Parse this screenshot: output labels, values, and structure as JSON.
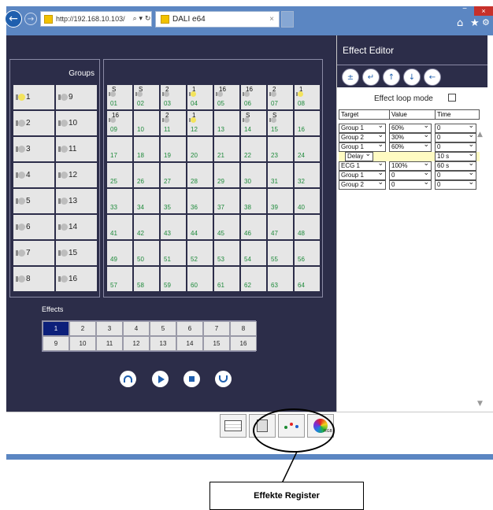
{
  "browser": {
    "url": "http://192.168.10.103/",
    "addr_tools": "⌕ ▾ ↻",
    "tab_title": "DALI e64",
    "tab_close": "×",
    "back_icon": "←",
    "forward_icon": "→",
    "min_icon": "−",
    "max_icon": "□",
    "close_icon": "×",
    "home_icon": "⌂",
    "star_icon": "★",
    "gear_icon": "⚙"
  },
  "groups": {
    "title": "Groups",
    "items": [
      {
        "label": "1",
        "on": true
      },
      {
        "label": "9",
        "on": false
      },
      {
        "label": "2",
        "on": false
      },
      {
        "label": "10",
        "on": false
      },
      {
        "label": "3",
        "on": false
      },
      {
        "label": "11",
        "on": false
      },
      {
        "label": "4",
        "on": false
      },
      {
        "label": "12",
        "on": false
      },
      {
        "label": "5",
        "on": false
      },
      {
        "label": "13",
        "on": false
      },
      {
        "label": "6",
        "on": false
      },
      {
        "label": "14",
        "on": false
      },
      {
        "label": "7",
        "on": false
      },
      {
        "label": "15",
        "on": false
      },
      {
        "label": "8",
        "on": false
      },
      {
        "label": "16",
        "on": false
      }
    ]
  },
  "ecgs": [
    {
      "num": "01",
      "tag": "S",
      "bulb": "off"
    },
    {
      "num": "02",
      "tag": "S",
      "bulb": "off"
    },
    {
      "num": "03",
      "tag": "2",
      "bulb": "off"
    },
    {
      "num": "04",
      "tag": "1",
      "bulb": "on"
    },
    {
      "num": "05",
      "tag": "16",
      "bulb": "off"
    },
    {
      "num": "06",
      "tag": "16",
      "bulb": "off"
    },
    {
      "num": "07",
      "tag": "2",
      "bulb": "off"
    },
    {
      "num": "08",
      "tag": "1",
      "bulb": "on"
    },
    {
      "num": "09",
      "tag": "16",
      "bulb": "off"
    },
    {
      "num": "10",
      "tag": "",
      "bulb": ""
    },
    {
      "num": "11",
      "tag": "2",
      "bulb": "off"
    },
    {
      "num": "12",
      "tag": "1",
      "bulb": "on"
    },
    {
      "num": "13",
      "tag": "",
      "bulb": ""
    },
    {
      "num": "14",
      "tag": "S",
      "bulb": "off"
    },
    {
      "num": "15",
      "tag": "S",
      "bulb": "off"
    },
    {
      "num": "16",
      "tag": "",
      "bulb": ""
    },
    {
      "num": "17",
      "tag": "",
      "bulb": ""
    },
    {
      "num": "18",
      "tag": "",
      "bulb": ""
    },
    {
      "num": "19",
      "tag": "",
      "bulb": ""
    },
    {
      "num": "20",
      "tag": "",
      "bulb": ""
    },
    {
      "num": "21",
      "tag": "",
      "bulb": ""
    },
    {
      "num": "22",
      "tag": "",
      "bulb": ""
    },
    {
      "num": "23",
      "tag": "",
      "bulb": ""
    },
    {
      "num": "24",
      "tag": "",
      "bulb": ""
    },
    {
      "num": "25",
      "tag": "",
      "bulb": ""
    },
    {
      "num": "26",
      "tag": "",
      "bulb": ""
    },
    {
      "num": "27",
      "tag": "",
      "bulb": ""
    },
    {
      "num": "28",
      "tag": "",
      "bulb": ""
    },
    {
      "num": "29",
      "tag": "",
      "bulb": ""
    },
    {
      "num": "30",
      "tag": "",
      "bulb": ""
    },
    {
      "num": "31",
      "tag": "",
      "bulb": ""
    },
    {
      "num": "32",
      "tag": "",
      "bulb": ""
    },
    {
      "num": "33",
      "tag": "",
      "bulb": ""
    },
    {
      "num": "34",
      "tag": "",
      "bulb": ""
    },
    {
      "num": "35",
      "tag": "",
      "bulb": ""
    },
    {
      "num": "36",
      "tag": "",
      "bulb": ""
    },
    {
      "num": "37",
      "tag": "",
      "bulb": ""
    },
    {
      "num": "38",
      "tag": "",
      "bulb": ""
    },
    {
      "num": "39",
      "tag": "",
      "bulb": ""
    },
    {
      "num": "40",
      "tag": "",
      "bulb": ""
    },
    {
      "num": "41",
      "tag": "",
      "bulb": ""
    },
    {
      "num": "42",
      "tag": "",
      "bulb": ""
    },
    {
      "num": "43",
      "tag": "",
      "bulb": ""
    },
    {
      "num": "44",
      "tag": "",
      "bulb": ""
    },
    {
      "num": "45",
      "tag": "",
      "bulb": ""
    },
    {
      "num": "46",
      "tag": "",
      "bulb": ""
    },
    {
      "num": "47",
      "tag": "",
      "bulb": ""
    },
    {
      "num": "48",
      "tag": "",
      "bulb": ""
    },
    {
      "num": "49",
      "tag": "",
      "bulb": ""
    },
    {
      "num": "50",
      "tag": "",
      "bulb": ""
    },
    {
      "num": "51",
      "tag": "",
      "bulb": ""
    },
    {
      "num": "52",
      "tag": "",
      "bulb": ""
    },
    {
      "num": "53",
      "tag": "",
      "bulb": ""
    },
    {
      "num": "54",
      "tag": "",
      "bulb": ""
    },
    {
      "num": "55",
      "tag": "",
      "bulb": ""
    },
    {
      "num": "56",
      "tag": "",
      "bulb": ""
    },
    {
      "num": "57",
      "tag": "",
      "bulb": ""
    },
    {
      "num": "58",
      "tag": "",
      "bulb": ""
    },
    {
      "num": "59",
      "tag": "",
      "bulb": ""
    },
    {
      "num": "60",
      "tag": "",
      "bulb": ""
    },
    {
      "num": "61",
      "tag": "",
      "bulb": ""
    },
    {
      "num": "62",
      "tag": "",
      "bulb": ""
    },
    {
      "num": "63",
      "tag": "",
      "bulb": ""
    },
    {
      "num": "64",
      "tag": "",
      "bulb": ""
    }
  ],
  "effects": {
    "label": "Effects",
    "selected": "1",
    "items": [
      "1",
      "2",
      "3",
      "4",
      "5",
      "6",
      "7",
      "8",
      "9",
      "10",
      "11",
      "12",
      "13",
      "14",
      "15",
      "16"
    ]
  },
  "editor": {
    "title": "Effect Editor",
    "loop_label": "Effect loop mode",
    "columns": [
      "Target",
      "Value",
      "Time"
    ],
    "rows": [
      {
        "target": "Group 1",
        "value": "60%",
        "time": "0",
        "delay": false
      },
      {
        "target": "Group 2",
        "value": "30%",
        "time": "0",
        "delay": false
      },
      {
        "target": "Group 1",
        "value": "60%",
        "time": "0",
        "delay": false
      },
      {
        "target": "Delay",
        "value": "",
        "time": "10 s",
        "delay": true
      },
      {
        "target": "ECG 1",
        "value": "100%",
        "time": "60 s",
        "delay": false
      },
      {
        "target": "Group 1",
        "value": "0",
        "time": "0",
        "delay": false
      },
      {
        "target": "Group 2",
        "value": "0",
        "time": "0",
        "delay": false
      }
    ],
    "toolbar_icons": [
      "±",
      "↵",
      "↑",
      "↓",
      "←"
    ],
    "scroll_up_icon": "▲",
    "scroll_down_icon": "▼"
  },
  "bottom_tabs": {
    "rgb_text": "RGB"
  },
  "annotation": {
    "callout": "Effekte Register"
  }
}
